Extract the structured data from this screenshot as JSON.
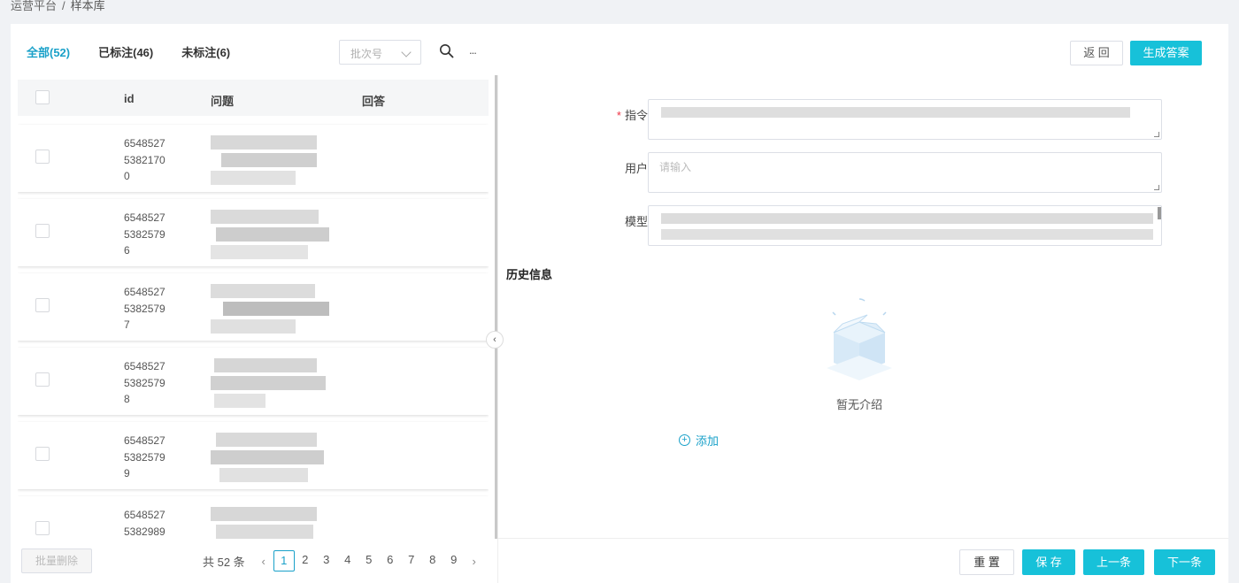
{
  "breadcrumb": {
    "root": "运营平台",
    "sep": "/",
    "current": "样本库"
  },
  "tabs": [
    {
      "label": "全部(52)",
      "active": true
    },
    {
      "label": "已标注(46)",
      "active": false
    },
    {
      "label": "未标注(6)",
      "active": false
    }
  ],
  "filter": {
    "batch_placeholder": "批次号",
    "more": "..."
  },
  "header_buttons": {
    "back": "返 回",
    "generate": "生成答案"
  },
  "table": {
    "columns": {
      "id": "id",
      "question": "问题",
      "answer": "回答"
    },
    "rows": [
      {
        "id": [
          "6548527",
          "5382170",
          "0"
        ]
      },
      {
        "id": [
          "6548527",
          "5382579",
          "6"
        ]
      },
      {
        "id": [
          "6548527",
          "5382579",
          "7"
        ]
      },
      {
        "id": [
          "6548527",
          "5382579",
          "8"
        ]
      },
      {
        "id": [
          "6548527",
          "5382579",
          "9"
        ]
      },
      {
        "id": [
          "6548527",
          "5382989",
          ""
        ]
      }
    ]
  },
  "bulk_delete": "批量删除",
  "pagination": {
    "total": "共 52 条",
    "pages": [
      "1",
      "2",
      "3",
      "4",
      "5",
      "6",
      "7",
      "8",
      "9"
    ],
    "current": "1"
  },
  "form": {
    "instruction_label": "指令",
    "user_label": "用户",
    "user_placeholder": "请输入",
    "model_label": "模型"
  },
  "history": {
    "title": "历史信息",
    "empty": "暂无介绍",
    "add": "添加"
  },
  "footer_buttons": {
    "reset": "重 置",
    "save": "保 存",
    "prev": "上一条",
    "next": "下一条"
  },
  "colors": {
    "accent": "#17c1d9",
    "link": "#1aa1c9"
  }
}
